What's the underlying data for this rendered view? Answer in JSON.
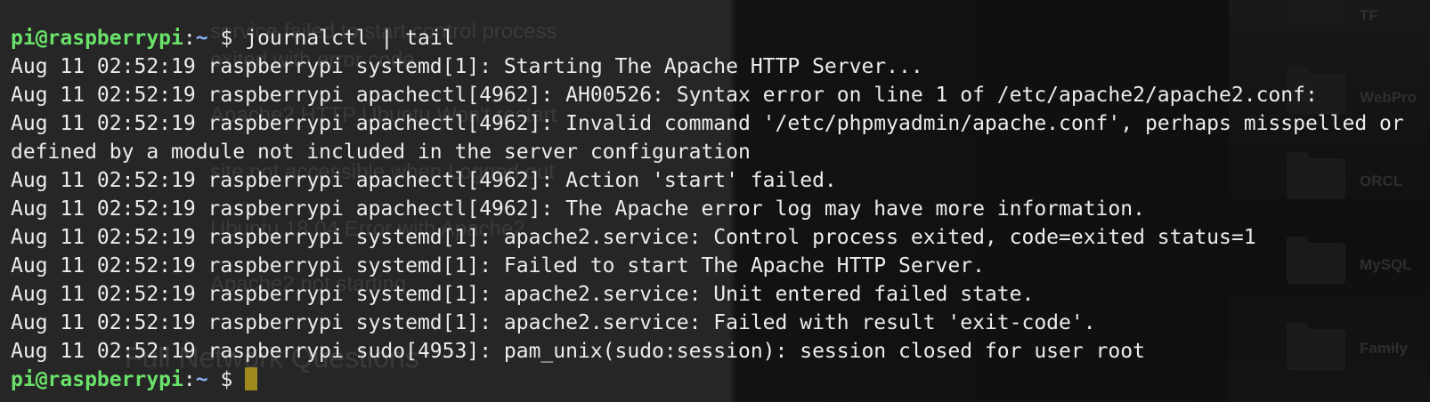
{
  "desktop": {
    "folders": [
      {
        "label": "TF"
      },
      {
        "label": "WebPro"
      },
      {
        "label": "ORCL"
      },
      {
        "label": "MySQL"
      },
      {
        "label": "Family"
      }
    ],
    "background_text": [
      "service failed to start control process",
      "exited with error code",
      "Apache2 HTTP Ubuntu Won't restart",
      "site not accessible when Logged out",
      "Ubuntu 18.04 Error with Apache2",
      "Apache2 not starting",
      "Full Network Questions"
    ]
  },
  "terminal": {
    "prompt": {
      "user_host": "pi@raspberrypi",
      "separator": ":",
      "path": "~",
      "symbol": "$"
    },
    "command": "journalctl | tail",
    "output": [
      "Aug 11 02:52:19 raspberrypi systemd[1]: Starting The Apache HTTP Server...",
      "Aug 11 02:52:19 raspberrypi apachectl[4962]: AH00526: Syntax error on line 1 of /etc/apache2/apache2.conf:",
      "Aug 11 02:52:19 raspberrypi apachectl[4962]: Invalid command '/etc/phpmyadmin/apache.conf', perhaps misspelled or",
      "defined by a module not included in the server configuration",
      "Aug 11 02:52:19 raspberrypi apachectl[4962]: Action 'start' failed.",
      "Aug 11 02:52:19 raspberrypi apachectl[4962]: The Apache error log may have more information.",
      "Aug 11 02:52:19 raspberrypi systemd[1]: apache2.service: Control process exited, code=exited status=1",
      "Aug 11 02:52:19 raspberrypi systemd[1]: Failed to start The Apache HTTP Server.",
      "Aug 11 02:52:19 raspberrypi systemd[1]: apache2.service: Unit entered failed state.",
      "Aug 11 02:52:19 raspberrypi systemd[1]: apache2.service: Failed with result 'exit-code'.",
      "Aug 11 02:52:19 raspberrypi sudo[4953]: pam_unix(sudo:session): session closed for user root"
    ]
  },
  "colors": {
    "prompt_user": "#6ae26a",
    "prompt_path": "#8ab4f8",
    "text": "#ececec",
    "cursor": "#a08a1e"
  }
}
